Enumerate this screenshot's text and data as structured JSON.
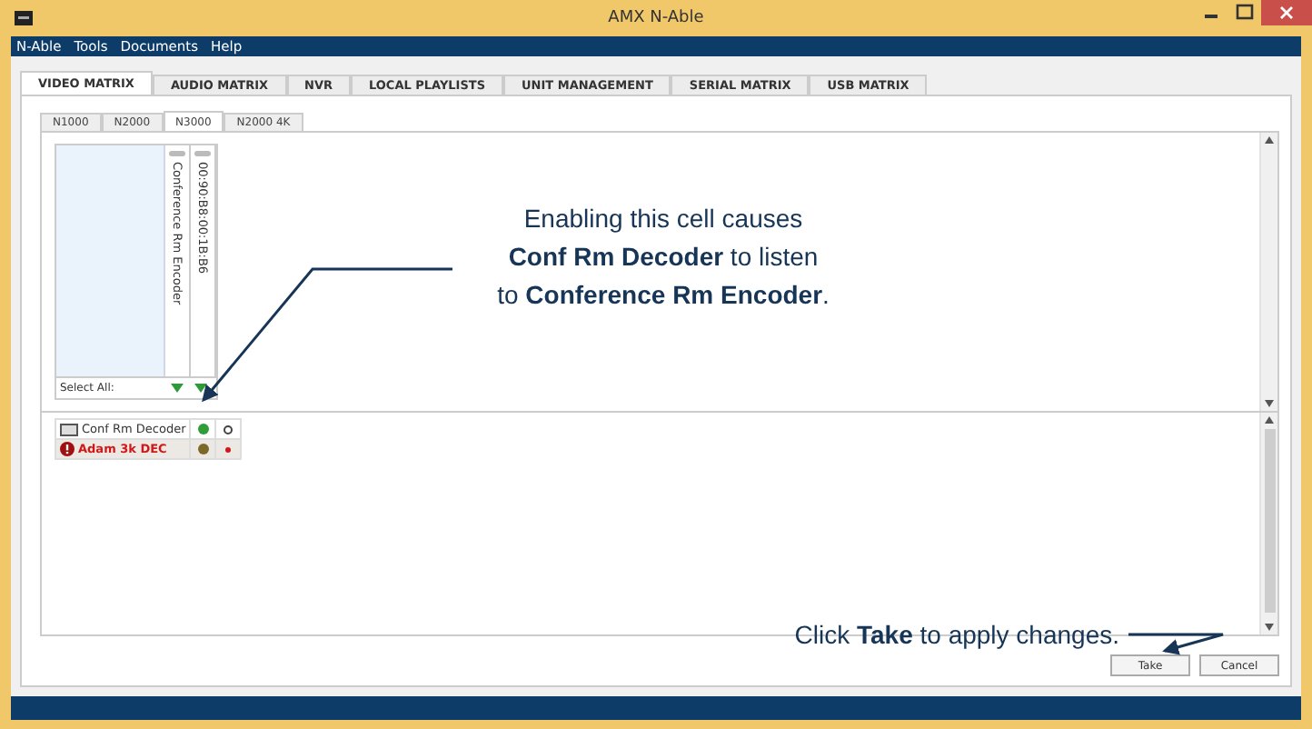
{
  "window": {
    "title": "AMX N-Able"
  },
  "menu": [
    "N-Able",
    "Tools",
    "Documents",
    "Help"
  ],
  "tabs": [
    {
      "label": "VIDEO MATRIX",
      "selected": true
    },
    {
      "label": "AUDIO MATRIX",
      "selected": false
    },
    {
      "label": "NVR",
      "selected": false
    },
    {
      "label": "LOCAL PLAYLISTS",
      "selected": false
    },
    {
      "label": "UNIT MANAGEMENT",
      "selected": false
    },
    {
      "label": "SERIAL MATRIX",
      "selected": false
    },
    {
      "label": "USB MATRIX",
      "selected": false
    }
  ],
  "subtabs": [
    {
      "label": "N1000",
      "selected": false
    },
    {
      "label": "N2000",
      "selected": false
    },
    {
      "label": "N3000",
      "selected": true
    },
    {
      "label": "N2000 4K",
      "selected": false
    }
  ],
  "matrix": {
    "columns": [
      {
        "label": "Conference Rm Encoder"
      },
      {
        "label": "00:90:B8:00:1B:B6"
      }
    ],
    "select_all": "Select All:",
    "rows": [
      {
        "name": "Conf Rm Decoder",
        "kind": "device",
        "cells": [
          {
            "kind": "enabled"
          },
          {
            "kind": "empty"
          }
        ]
      },
      {
        "name": "Adam 3k DEC",
        "kind": "error",
        "cells": [
          {
            "kind": "disabled"
          },
          {
            "kind": "error"
          }
        ]
      }
    ]
  },
  "callouts": [
    {
      "text": "Enabling this cell causes\n**Conf Rm Decoder** to listen\nto **Conference Rm Encoder**."
    },
    {
      "text": "Click **Take** to apply changes."
    }
  ],
  "buttons": [
    "Take",
    "Cancel"
  ]
}
